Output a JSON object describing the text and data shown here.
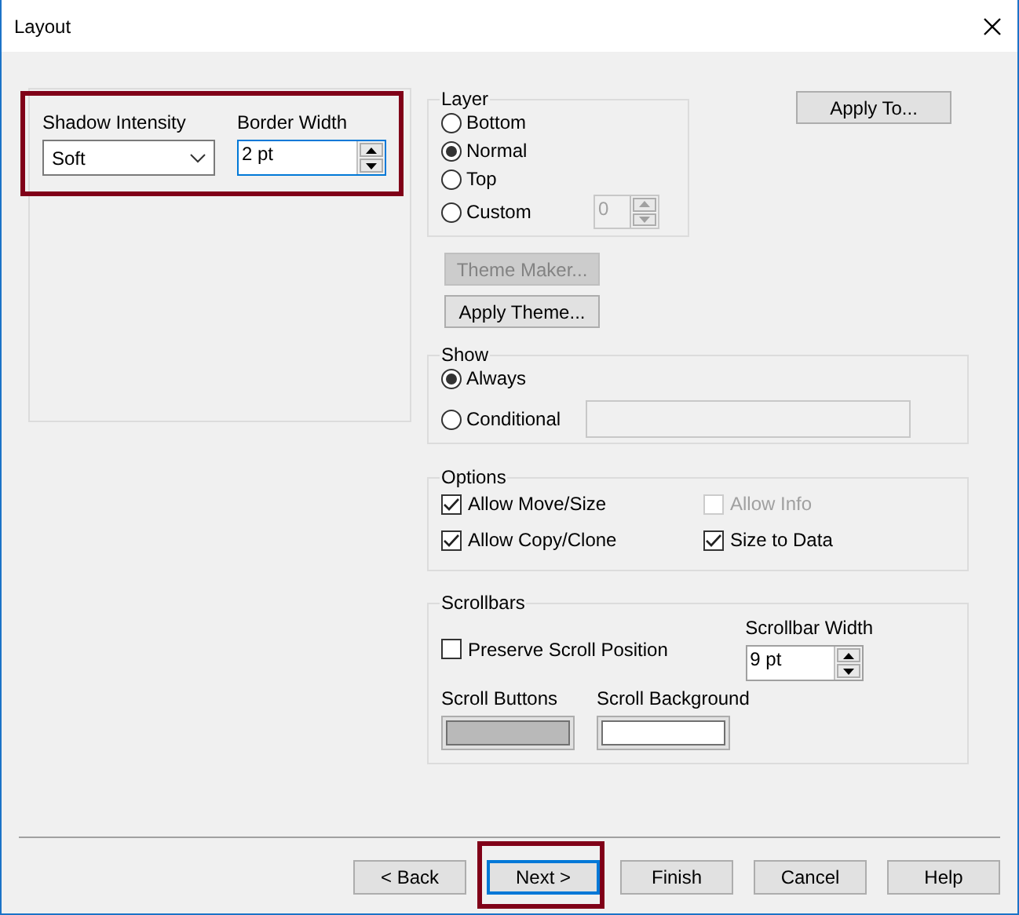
{
  "window": {
    "title": "Layout"
  },
  "shadow_intensity": {
    "label": "Shadow Intensity",
    "value": "Soft"
  },
  "border_width": {
    "label": "Border Width",
    "value": "2 pt"
  },
  "layer": {
    "title": "Layer",
    "custom_value": "0",
    "custom_disabled": true,
    "options": [
      {
        "label": "Bottom",
        "selected": false
      },
      {
        "label": "Normal",
        "selected": true
      },
      {
        "label": "Top",
        "selected": false
      },
      {
        "label": "Custom",
        "selected": false
      }
    ]
  },
  "apply_to": "Apply To...",
  "theme_buttons": [
    {
      "label": "Theme Maker...",
      "disabled": true
    },
    {
      "label": "Apply Theme...",
      "disabled": false
    }
  ],
  "show": {
    "title": "Show",
    "options": [
      {
        "label": "Always",
        "selected": true
      },
      {
        "label": "Conditional",
        "selected": false
      }
    ]
  },
  "options": {
    "title": "Options",
    "items": [
      {
        "label": "Allow Move/Size",
        "checked": true,
        "disabled": false
      },
      {
        "label": "Allow Info",
        "checked": false,
        "disabled": true
      },
      {
        "label": "Allow Copy/Clone",
        "checked": true,
        "disabled": false
      },
      {
        "label": "Size to Data",
        "checked": true,
        "disabled": false
      }
    ]
  },
  "scrollbars": {
    "title": "Scrollbars",
    "preserve": {
      "label": "Preserve Scroll Position",
      "checked": false
    },
    "width": {
      "label": "Scrollbar Width",
      "value": "9 pt"
    },
    "colors": [
      {
        "label": "Scroll Buttons",
        "color": "#b9b9b9"
      },
      {
        "label": "Scroll Background",
        "color": "#ffffff"
      }
    ]
  },
  "buttons": [
    {
      "label": "< Back",
      "focused": false
    },
    {
      "label": "Next >",
      "focused": true
    },
    {
      "label": "Finish",
      "focused": false
    },
    {
      "label": "Cancel",
      "focused": false
    },
    {
      "label": "Help",
      "focused": false
    }
  ]
}
